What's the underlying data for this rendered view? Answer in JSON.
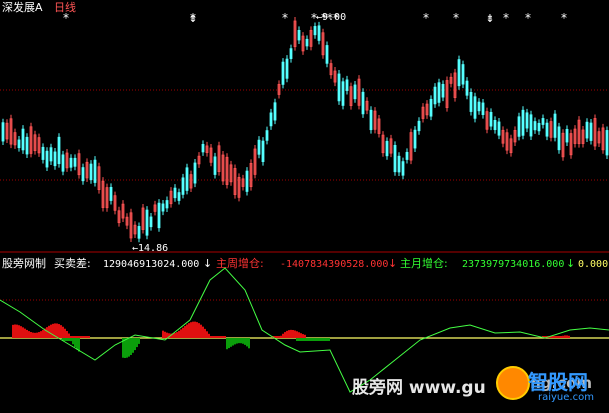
{
  "colors": {
    "background": "#000000",
    "up": "#ff5555",
    "down": "#55ffff",
    "white": "#ffffff",
    "red": "#ff3333",
    "green": "#33ff33",
    "grid_red": "#a00000",
    "yellow_line": "#ffff66"
  },
  "top_panel": {
    "title": "深发展A",
    "period": "日线",
    "low_annotation": "←14.86",
    "high_annotation": "←9.00",
    "star_glyph": "*",
    "arrow_glyph": "⇟"
  },
  "bottom_panel": {
    "name": "股旁网制",
    "s1_label": "买卖差:",
    "s1_value": "129046913024.000",
    "s2_label": "主周增仓:",
    "s2_value": "-1407834390528.000",
    "s3_label": "主月增仓:",
    "s3_value": "2373979734016.000",
    "s4_value": "0.000",
    "down_arrow": "↓"
  },
  "watermark": {
    "site1": "股旁网 www.gu",
    "site2": "ang.com",
    "logo_text": "智股网",
    "logo_sub": "raiyue.com"
  }
}
